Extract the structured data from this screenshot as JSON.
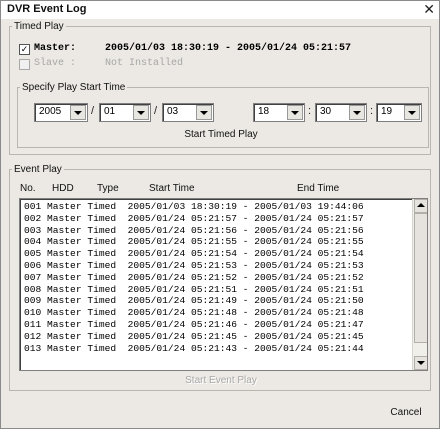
{
  "window": {
    "title": "DVR Event Log",
    "close_glyph": "✕"
  },
  "timed_play": {
    "legend": "Timed Play",
    "master": {
      "checked": true,
      "label": "Master:",
      "range": "2005/01/03 18:30:19 - 2005/01/24 05:21:57"
    },
    "slave": {
      "checked": false,
      "label": "Slave :",
      "status": "Not Installed"
    }
  },
  "start_time": {
    "legend": "Specify Play Start Time",
    "year": "2005",
    "month": "01",
    "day": "03",
    "hour": "18",
    "minute": "30",
    "second": "19",
    "date_sep": "/",
    "time_sep": ":",
    "start_button": "Start Timed Play"
  },
  "event_play": {
    "legend": "Event Play",
    "columns": {
      "no": "No.",
      "hdd": "HDD",
      "type": "Type",
      "start": "Start Time",
      "end": "End Time"
    },
    "rows": [
      "001 Master Timed  2005/01/03 18:30:19 - 2005/01/03 19:44:06",
      "002 Master Timed  2005/01/24 05:21:57 - 2005/01/24 05:21:57",
      "003 Master Timed  2005/01/24 05:21:56 - 2005/01/24 05:21:56",
      "004 Master Timed  2005/01/24 05:21:55 - 2005/01/24 05:21:55",
      "005 Master Timed  2005/01/24 05:21:54 - 2005/01/24 05:21:54",
      "006 Master Timed  2005/01/24 05:21:53 - 2005/01/24 05:21:53",
      "007 Master Timed  2005/01/24 05:21:52 - 2005/01/24 05:21:52",
      "008 Master Timed  2005/01/24 05:21:51 - 2005/01/24 05:21:51",
      "009 Master Timed  2005/01/24 05:21:49 - 2005/01/24 05:21:50",
      "010 Master Timed  2005/01/24 05:21:48 - 2005/01/24 05:21:48",
      "011 Master Timed  2005/01/24 05:21:46 - 2005/01/24 05:21:47",
      "012 Master Timed  2005/01/24 05:21:45 - 2005/01/24 05:21:45",
      "013 Master Timed  2005/01/24 05:21:43 - 2005/01/24 05:21:44"
    ],
    "start_button": "Start Event Play"
  },
  "cancel_button": "Cancel"
}
